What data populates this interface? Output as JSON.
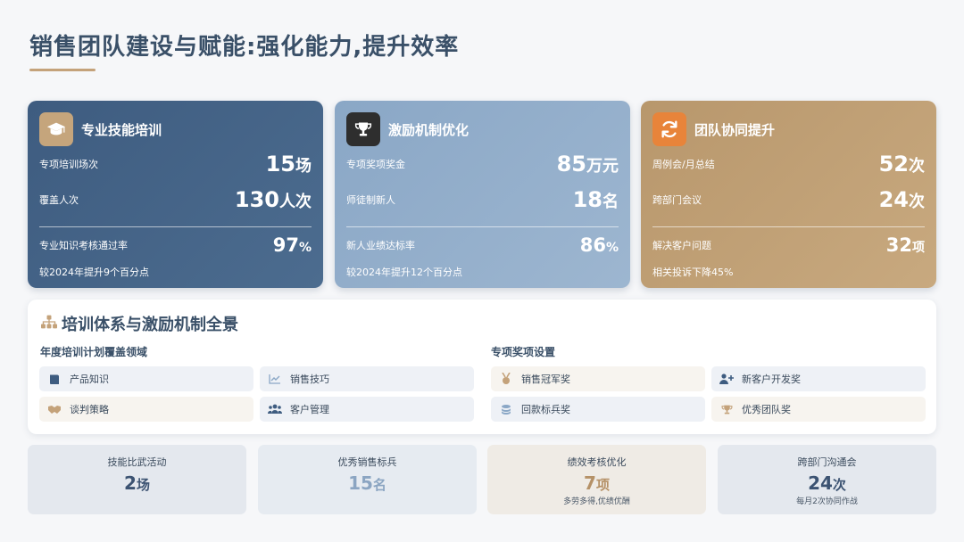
{
  "page": {
    "title": "销售团队建设与赋能:强化能力,提升效率"
  },
  "cards": [
    {
      "title": "专业技能培训",
      "icon": "graduation-cap-icon",
      "row1": {
        "label": "专项培训场次",
        "value": "15",
        "unit": "场"
      },
      "row2": {
        "label": "覆盖人次",
        "value": "130",
        "unit": "人次"
      },
      "row3": {
        "label": "专业知识考核通过率",
        "value": "97",
        "unit": "%"
      },
      "note": "较2024年提升9个百分点"
    },
    {
      "title": "激励机制优化",
      "icon": "trophy-icon",
      "row1": {
        "label": "专项奖项奖金",
        "value": "85",
        "unit": "万元"
      },
      "row2": {
        "label": "师徒制新人",
        "value": "18",
        "unit": "名"
      },
      "row3": {
        "label": "新人业绩达标率",
        "value": "86",
        "unit": "%"
      },
      "note": "较2024年提升12个百分点"
    },
    {
      "title": "团队协同提升",
      "icon": "sync-icon",
      "row1": {
        "label": "周例会/月总结",
        "value": "52",
        "unit": "次"
      },
      "row2": {
        "label": "跨部门会议",
        "value": "24",
        "unit": "次"
      },
      "row3": {
        "label": "解决客户问题",
        "value": "32",
        "unit": "项"
      },
      "note": "相关投诉下降45%"
    }
  ],
  "panel": {
    "title": "培训体系与激励机制全景",
    "left_heading": "年度培训计划覆盖领域",
    "right_heading": "专项奖项设置",
    "training_areas": [
      {
        "label": "产品知识",
        "icon": "book-icon"
      },
      {
        "label": "销售技巧",
        "icon": "line-chart-icon"
      },
      {
        "label": "谈判策略",
        "icon": "handshake-icon"
      },
      {
        "label": "客户管理",
        "icon": "users-icon"
      }
    ],
    "awards": [
      {
        "label": "销售冠军奖",
        "icon": "medal-icon"
      },
      {
        "label": "新客户开发奖",
        "icon": "user-plus-icon"
      },
      {
        "label": "回款标兵奖",
        "icon": "coins-icon"
      },
      {
        "label": "优秀团队奖",
        "icon": "trophy-icon"
      }
    ]
  },
  "stats": [
    {
      "title": "技能比武活动",
      "value": "2",
      "unit": "场",
      "note": ""
    },
    {
      "title": "优秀销售标兵",
      "value": "15",
      "unit": "名",
      "note": ""
    },
    {
      "title": "绩效考核优化",
      "value": "7",
      "unit": "项",
      "note": "多劳多得,优绩优酬"
    },
    {
      "title": "跨部门沟通会",
      "value": "24",
      "unit": "次",
      "note": "每月2次协同作战"
    }
  ],
  "colors": {
    "card1": "#3e5c80",
    "card2": "#8aa7c6",
    "card3": "#b8976c",
    "accent": "#c4a27a",
    "title": "#3a5068"
  }
}
